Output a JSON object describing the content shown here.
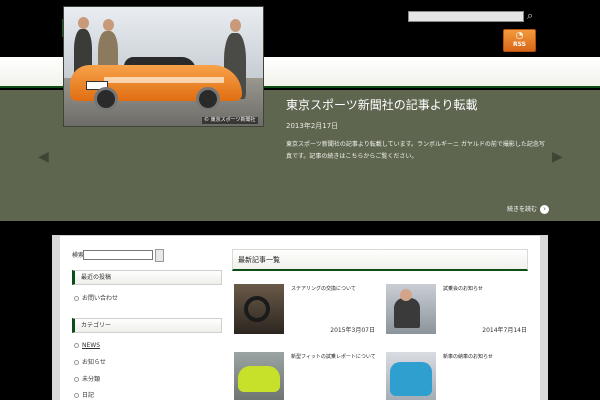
{
  "header": {
    "logo_text": "",
    "tagline": "",
    "search_placeholder": "",
    "rss_label": "RSS"
  },
  "slider": {
    "title": "東京スポーツ新聞社の記事より転載",
    "date": "2013年2月17日",
    "excerpt": "東京スポーツ新聞社の記事より転載しています。ランボルギーニ ガヤルドの前で撮影した記念写真です。記事の続きはこちらからご覧ください。",
    "photo_credit": "© 東京スポーツ新聞社",
    "more_label": "続きを読む",
    "prev_glyph": "◀",
    "next_glyph": "▶"
  },
  "sidebar": {
    "search_label": "検索",
    "search_value": "",
    "widgets": [
      {
        "title": "最近の投稿",
        "links": [
          "お問い合わせ"
        ]
      },
      {
        "title": "カテゴリー",
        "links": [
          "NEWS",
          "お知らせ",
          "未分類",
          "日記"
        ]
      }
    ]
  },
  "main": {
    "heading": "最新記事一覧",
    "posts": [
      {
        "title": "ステアリングの交換について",
        "date": "2015年3月07日"
      },
      {
        "title": "試乗会のお知らせ",
        "date": "2014年7月14日"
      },
      {
        "title": "新型フィットの試乗レポートについて",
        "date": ""
      },
      {
        "title": "新車の納車のお知らせ",
        "date": ""
      }
    ]
  },
  "colors": {
    "accent_green": "#0e4d16",
    "slider_bg": "#5e6650",
    "rss_orange": "#e57a24"
  }
}
